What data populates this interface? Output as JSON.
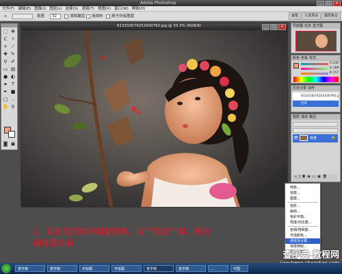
{
  "app": {
    "title": "Adobe Photoshop"
  },
  "menu": [
    "文件(F)",
    "编辑(E)",
    "图像(I)",
    "图层(L)",
    "选择(S)",
    "滤镜(T)",
    "视图(V)",
    "窗口(W)",
    "帮助(H)"
  ],
  "options": {
    "tolerance_label": "容差:",
    "tolerance_value": "32",
    "antialias_label": "消除锯齿",
    "contiguous_label": "连续的",
    "all_layers_label": "用于所有图层",
    "panel_tabs": [
      "画笔",
      "工具预设",
      "图层复合"
    ]
  },
  "document": {
    "title": "613333074253430792.jpg @ 33.3% (RGB/8)"
  },
  "panels": {
    "navigator_tabs": [
      "导航器",
      "信息",
      "直方图"
    ],
    "color_tabs": [
      "颜色",
      "色板",
      "样式"
    ],
    "color_values": [
      "R 236",
      "G 188",
      "B 157"
    ],
    "history_tabs": [
      "历史记录",
      "动作"
    ],
    "history_item": "613333074253430792.jpg",
    "history_item2": "打开",
    "layers_tabs": [
      "图层",
      "通道",
      "路径"
    ],
    "layer_name": "背景"
  },
  "context_menu": {
    "items": [
      "纯色...",
      "渐变...",
      "图案...",
      "色阶...",
      "曲线...",
      "色彩平衡...",
      "亮度/对比度...",
      "色相/饱和度...",
      "可选颜色...",
      "通道混合器...",
      "渐变映射...",
      "照片滤镜...",
      "反相",
      "色调分离..."
    ],
    "selected_index": 9
  },
  "caption": {
    "line1": "2、现在我们就来调整图像，点下面这个键，执行",
    "line2": "通道混合器"
  },
  "taskbar": {
    "items": [
      "查字典",
      "查字典",
      "无标题",
      "字体图",
      "查字典",
      "查字典",
      "...",
      "中国"
    ]
  },
  "watermark": {
    "line1": "查字典 教程网",
    "line2": "jiaocheng.chazidian.com"
  },
  "colors": {
    "fg_swatch": "#f0a07a",
    "menu_highlight": "#2f60c8",
    "caption": "#e8162a"
  }
}
